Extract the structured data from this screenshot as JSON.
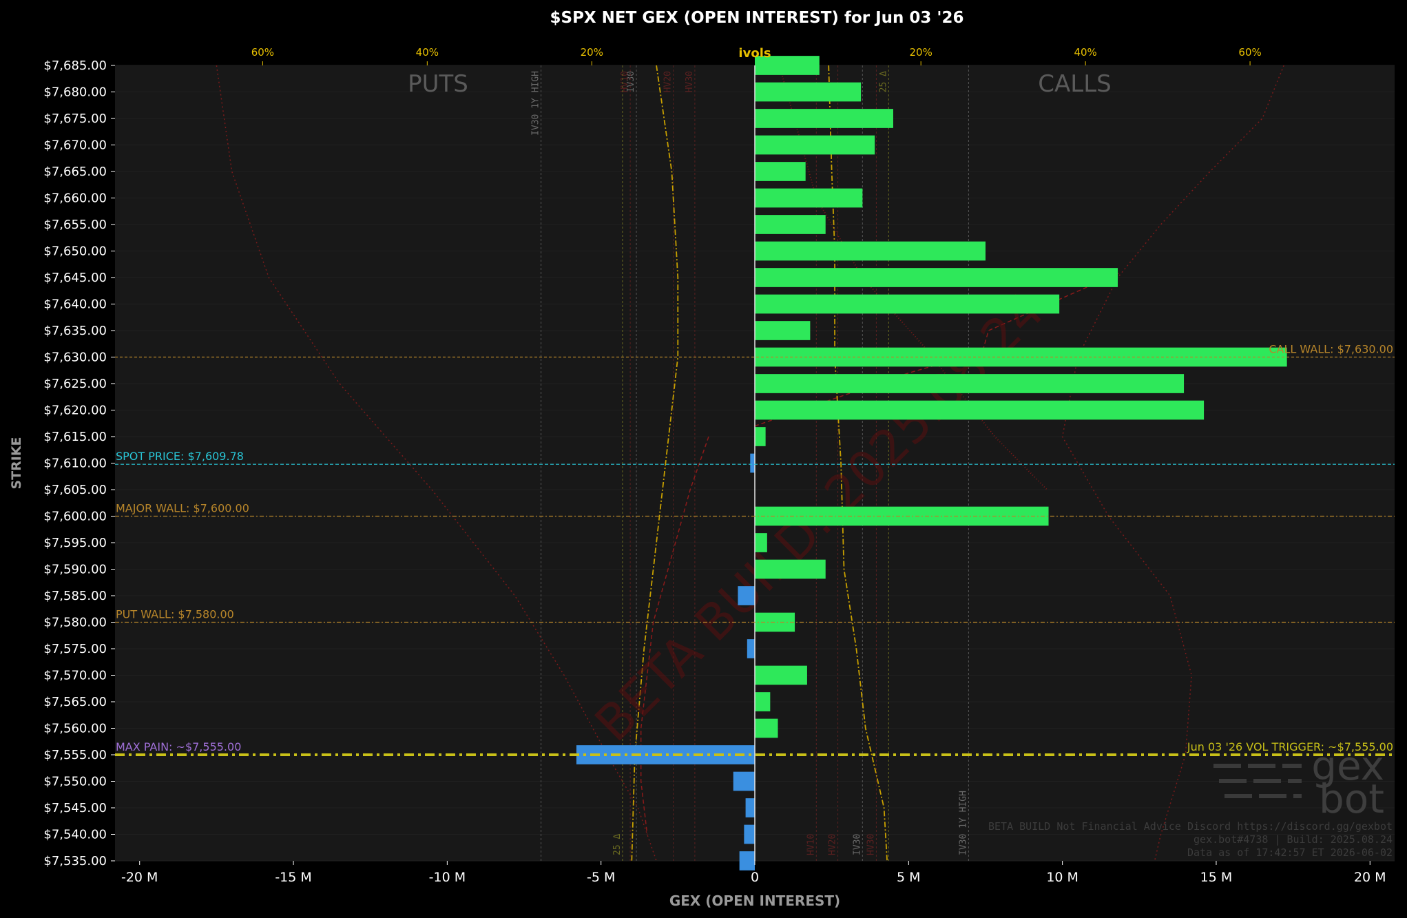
{
  "chart_data": {
    "type": "bar",
    "orientation": "horizontal",
    "title": "$SPX NET GEX (OPEN INTEREST) for Jun 03 '26",
    "xlabel": "GEX (OPEN INTEREST)",
    "ylabel": "STRIKE",
    "xlim": [
      -20.8,
      20.8
    ],
    "ylim": [
      7535,
      7685
    ],
    "x_ticks": [
      -20,
      -15,
      -10,
      -5,
      0,
      5,
      10,
      15,
      20
    ],
    "x_tick_labels": [
      "-20 M",
      "-15 M",
      "-10 M",
      "-5 M",
      "0",
      "5 M",
      "10 M",
      "15 M",
      "20 M"
    ],
    "ivol_axis": {
      "label": "ivols",
      "ticks": [
        {
          "label": "60%",
          "x": -16
        },
        {
          "label": "40%",
          "x": -10.65
        },
        {
          "label": "20%",
          "x": -5.3
        },
        {
          "label": "20%",
          "x": 5.4
        },
        {
          "label": "40%",
          "x": 10.75
        },
        {
          "label": "60%",
          "x": 16.1
        }
      ]
    },
    "strikes": [
      7685,
      7680,
      7675,
      7670,
      7665,
      7660,
      7655,
      7650,
      7645,
      7640,
      7635,
      7630,
      7625,
      7620,
      7615,
      7610,
      7605,
      7600,
      7595,
      7590,
      7585,
      7580,
      7575,
      7570,
      7565,
      7560,
      7555,
      7550,
      7545,
      7540,
      7535
    ],
    "strike_labels": [
      "$7,685.00",
      "$7,680.00",
      "$7,675.00",
      "$7,670.00",
      "$7,665.00",
      "$7,660.00",
      "$7,655.00",
      "$7,650.00",
      "$7,645.00",
      "$7,640.00",
      "$7,635.00",
      "$7,630.00",
      "$7,625.00",
      "$7,620.00",
      "$7,615.00",
      "$7,610.00",
      "$7,605.00",
      "$7,600.00",
      "$7,595.00",
      "$7,590.00",
      "$7,585.00",
      "$7,580.00",
      "$7,575.00",
      "$7,570.00",
      "$7,565.00",
      "$7,560.00",
      "$7,555.00",
      "$7,550.00",
      "$7,545.00",
      "$7,540.00",
      "$7,535.00"
    ],
    "values": [
      2.1,
      3.45,
      4.5,
      3.9,
      1.65,
      3.5,
      2.3,
      7.5,
      11.8,
      9.9,
      1.8,
      17.3,
      13.95,
      14.6,
      0.35,
      -0.15,
      0,
      9.55,
      0.4,
      2.3,
      -0.55,
      1.3,
      -0.25,
      1.7,
      0.5,
      0.75,
      -5.8,
      -0.7,
      -0.3,
      -0.35,
      -0.5
    ],
    "positive_color": "#2ee85a",
    "negative_color": "#3a8fe0",
    "side_labels": {
      "puts": "PUTS",
      "calls": "CALLS"
    },
    "levels": [
      {
        "label": "SPOT PRICE: $7,609.78",
        "strike": 7609.78,
        "color": "#29c5d6",
        "style": "dashed",
        "side": "left"
      },
      {
        "label": "MAJOR WALL: $7,600.00",
        "strike": 7600,
        "color": "#b8862a",
        "style": "dashdot",
        "side": "left"
      },
      {
        "label": "PUT WALL: $7,580.00",
        "strike": 7580,
        "color": "#b8862a",
        "style": "dashdot",
        "side": "left"
      },
      {
        "label": "MAX PAIN: ~$7,555.00",
        "strike": 7555,
        "color": "#a070d8",
        "style": "none",
        "side": "left"
      },
      {
        "label": "CALL WALL: $7,630.00",
        "strike": 7630,
        "color": "#b8862a",
        "style": "dashed-thin",
        "side": "right"
      },
      {
        "label": "Jun 03 '26 VOL TRIGGER: ~$7,555.00",
        "strike": 7555,
        "color": "#c8c018",
        "style": "thick-dashdot",
        "side": "right"
      }
    ],
    "vertical_markers": [
      {
        "label": "IV30 1Y HIGH",
        "x": -6.95,
        "label_pos": "top"
      },
      {
        "label": "IV30",
        "x": -3.85,
        "label_pos": "top"
      },
      {
        "label": "HV10",
        "x": -4.05,
        "label_pos": "top"
      },
      {
        "label": "HV20",
        "x": -2.65,
        "label_pos": "top"
      },
      {
        "label": "HV30",
        "x": -1.95,
        "label_pos": "top"
      },
      {
        "label": "25 Δ",
        "x": 4.35,
        "label_pos": "top"
      },
      {
        "label": "25 Δ",
        "x": -4.3,
        "label_pos": "bottom"
      },
      {
        "label": "HV10",
        "x": 2.0,
        "label_pos": "bottom"
      },
      {
        "label": "HV20",
        "x": 2.7,
        "label_pos": "bottom"
      },
      {
        "label": "IV30",
        "x": 3.5,
        "label_pos": "bottom"
      },
      {
        "label": "HV30",
        "x": 3.95,
        "label_pos": "bottom"
      },
      {
        "label": "IV30 1Y HIGH",
        "x": 6.95,
        "label_pos": "bottom"
      }
    ],
    "watermark": "BETA BUILD: 2025.08.24",
    "footer_lines": [
      "BETA BUILD Not Financial Advice Discord https://discord.gg/gexbot",
      "gex.bot#4738 | Build: 2025.08.24",
      "Data as of 17:42:57 ET 2026-06-02"
    ],
    "logo_text": [
      "gex",
      "bot"
    ]
  }
}
